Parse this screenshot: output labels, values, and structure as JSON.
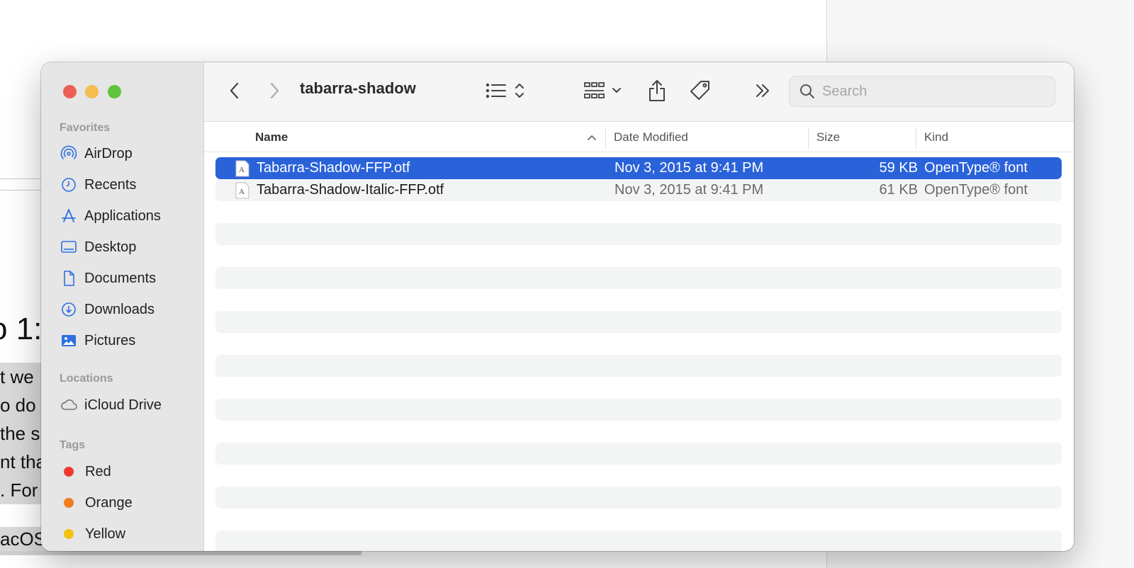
{
  "background_doc": {
    "heading_fragment": "o 1:",
    "para_lines": [
      "t we",
      "o do",
      "the s",
      "nt tha",
      ". For"
    ],
    "last_line": "acOS"
  },
  "window": {
    "title": "tabarra-shadow",
    "search": {
      "placeholder": "Search",
      "value": ""
    }
  },
  "sidebar": {
    "favorites_label": "Favorites",
    "favorites": [
      {
        "label": "AirDrop",
        "icon": "airdrop-icon"
      },
      {
        "label": "Recents",
        "icon": "clock-icon"
      },
      {
        "label": "Applications",
        "icon": "applications-icon"
      },
      {
        "label": "Desktop",
        "icon": "desktop-icon"
      },
      {
        "label": "Documents",
        "icon": "document-icon"
      },
      {
        "label": "Downloads",
        "icon": "download-icon"
      },
      {
        "label": "Pictures",
        "icon": "pictures-icon"
      }
    ],
    "locations_label": "Locations",
    "locations": [
      {
        "label": "iCloud Drive",
        "icon": "cloud-icon"
      }
    ],
    "tags_label": "Tags",
    "tags": [
      {
        "label": "Red",
        "color": "#ee3b32"
      },
      {
        "label": "Orange",
        "color": "#f07f1b"
      },
      {
        "label": "Yellow",
        "color": "#f4c20f"
      }
    ]
  },
  "columns": {
    "name": "Name",
    "date_modified": "Date Modified",
    "size": "Size",
    "kind": "Kind"
  },
  "files": [
    {
      "name": "Tabarra-Shadow-FFP.otf",
      "date": "Nov 3, 2015 at 9:41 PM",
      "size": "59 KB",
      "kind": "OpenType® font",
      "selected": true
    },
    {
      "name": "Tabarra-Shadow-Italic-FFP.otf",
      "date": "Nov 3, 2015 at 9:41 PM",
      "size": "61 KB",
      "kind": "OpenType® font",
      "selected": false
    }
  ],
  "colors": {
    "selection": "#2a62d9",
    "accent_icon": "#2f6fe0"
  }
}
